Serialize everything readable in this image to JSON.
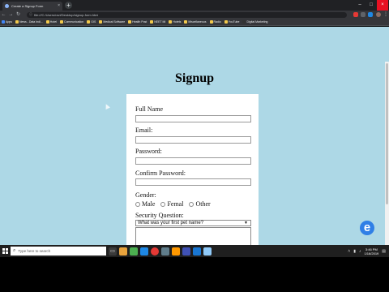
{
  "browser": {
    "tab_title": "Create a Signup Form",
    "tab_close": "×",
    "new_tab": "+",
    "window_controls": [
      "–",
      "□",
      "×"
    ],
    "nav": [
      "←",
      "→",
      "↻"
    ],
    "url": "file:///C:/Users/ravi/Desktop/signup-form.html",
    "bookmarks": [
      "Apps",
      "News - Data Indi...",
      "Hotel",
      "Communication",
      "GIS",
      "Medical Software",
      "Health Post",
      "NEET MI",
      "Hotels",
      "Miscellaneous",
      "Radio",
      "YouTube",
      "Digital Marketing"
    ]
  },
  "page": {
    "title": "Signup",
    "form": {
      "full_name_label": "Full Name",
      "email_label": "Email:",
      "password_label": "Password:",
      "confirm_password_label": "Confirm Password:",
      "gender_label": "Gender:",
      "gender_options": [
        "Male",
        "Femal",
        "Other"
      ],
      "security_label": "Security Question:",
      "security_selected": "What was your first pet name?"
    }
  },
  "watermark": "e",
  "taskbar": {
    "search_placeholder": "Type here to search",
    "clock_time": "3:46 PM",
    "clock_date": "1/16/2019"
  },
  "colors": {
    "page_background": "#add8e6",
    "card_background": "#ffffff",
    "taskbar": "#1f1f1f",
    "accent": "#2f7fe6"
  }
}
